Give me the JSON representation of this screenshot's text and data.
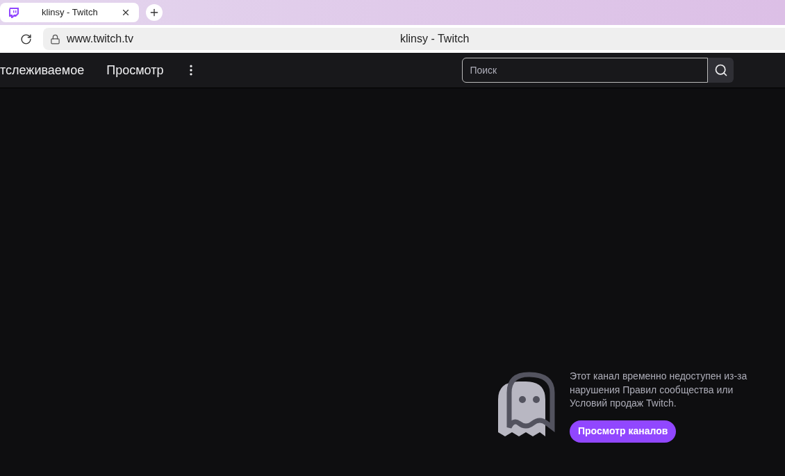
{
  "browser": {
    "tab": {
      "title": "klinsy - Twitch"
    },
    "address": "www.twitch.tv",
    "page_title": "klinsy - Twitch"
  },
  "nav": {
    "links": [
      {
        "label": "тслеживаемое"
      },
      {
        "label": "Просмотр"
      }
    ],
    "search": {
      "placeholder": "Поиск"
    }
  },
  "notice": {
    "message": "Этот канал временно недоступен из-за нарушения Правил сообщества или Условий продаж Twitch.",
    "button": "Просмотр каналов"
  }
}
